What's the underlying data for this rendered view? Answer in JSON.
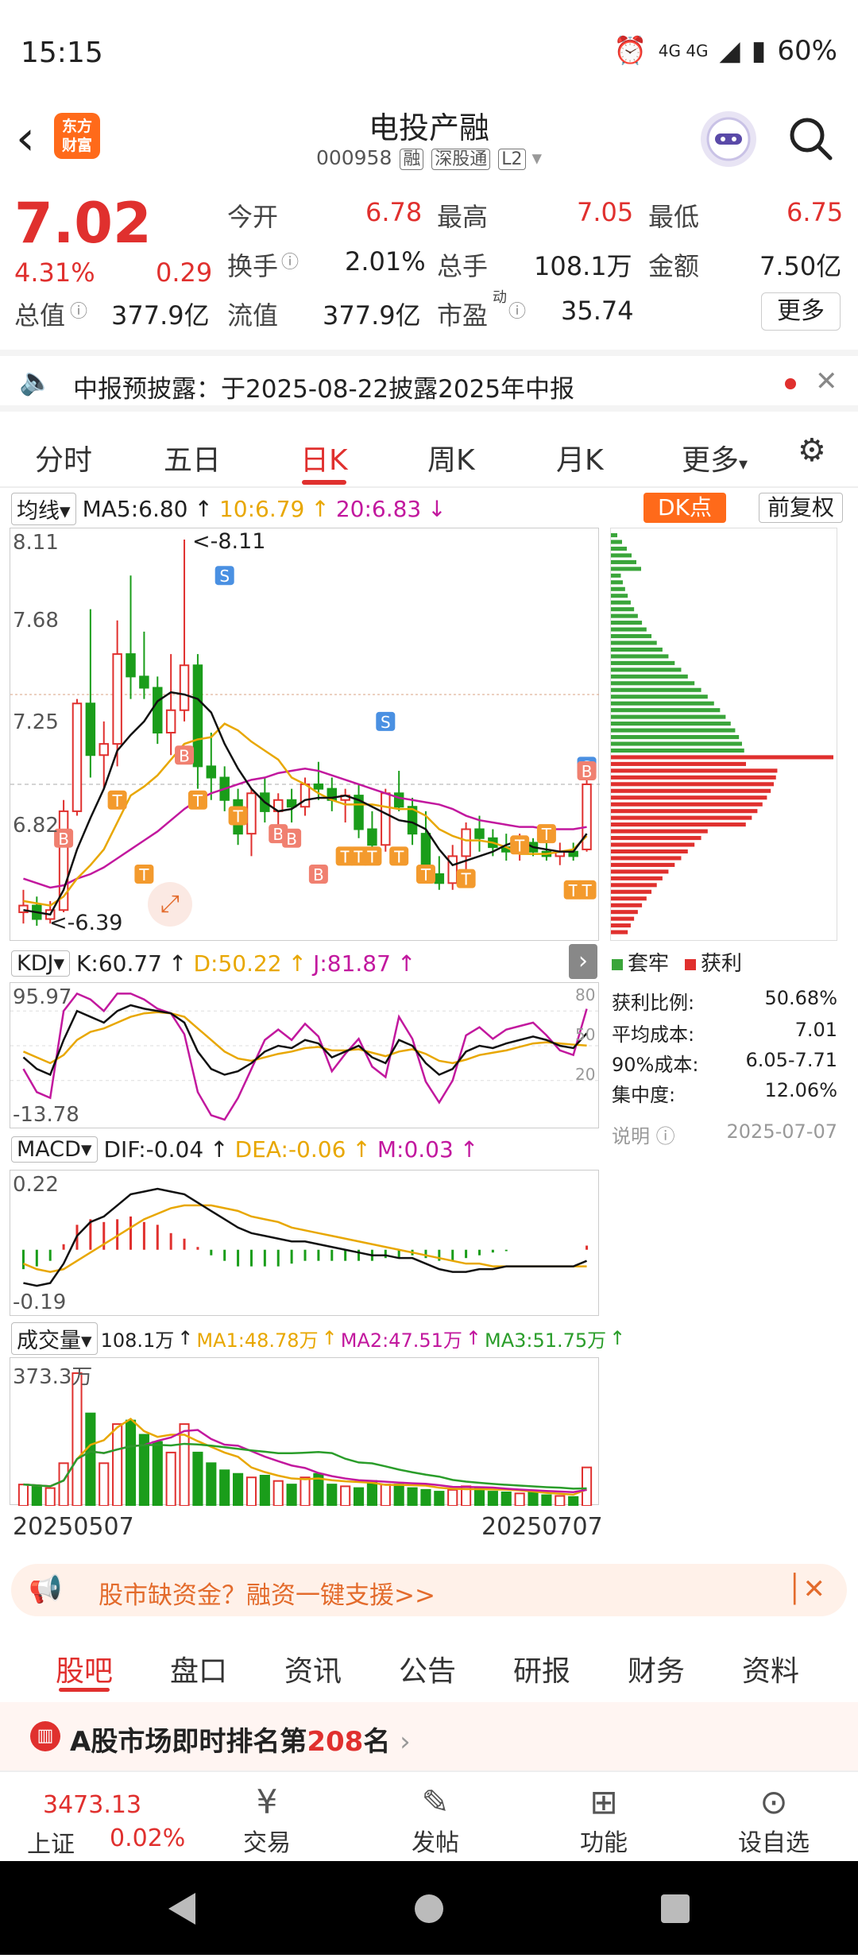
{
  "status_bar": {
    "time": "15:15",
    "network": "4G 4G",
    "battery": "60%"
  },
  "header": {
    "title": "电投产融",
    "code": "000958",
    "tags": [
      "融",
      "深股通",
      "L2"
    ],
    "logo_text": "东方财富"
  },
  "quote": {
    "price": "7.02",
    "change_pct": "4.31%",
    "change": "0.29",
    "open_label": "今开",
    "open": "6.78",
    "high_label": "最高",
    "high": "7.05",
    "low_label": "最低",
    "low": "6.75",
    "turnover_label": "换手",
    "turnover": "2.01%",
    "volume_label": "总手",
    "volume": "108.1万",
    "amount_label": "金额",
    "amount": "7.50亿",
    "total_mv_label": "总值",
    "total_mv": "377.9亿",
    "float_mv_label": "流值",
    "float_mv": "377.9亿",
    "pe_label": "市盈",
    "pe_sup": "动",
    "pe": "35.74",
    "more": "更多"
  },
  "notice": {
    "text": "中报预披露：于2025-08-22披露2025年中报"
  },
  "tabs": [
    "分时",
    "五日",
    "日K",
    "周K",
    "月K",
    "更多"
  ],
  "active_tab": "日K",
  "ma": {
    "selector": "均线",
    "ma5": "MA5:6.80",
    "ma10": "10:6.79",
    "ma20": "20:6.83",
    "dk": "DK点",
    "adjust": "前复权"
  },
  "kline_axis": {
    "y_labels": [
      "8.11",
      "7.68",
      "7.25",
      "6.82",
      "6.39"
    ],
    "high_mark": "<-8.11",
    "low_mark": "<-6.39"
  },
  "kdj": {
    "selector": "KDJ",
    "k": "K:60.77",
    "d": "D:50.22",
    "j": "J:81.87",
    "y_top": "95.97",
    "y_bottom": "-13.78",
    "right_labels": [
      "80",
      "50",
      "20"
    ]
  },
  "macd": {
    "selector": "MACD",
    "dif": "DIF:-0.04",
    "dea": "DEA:-0.06",
    "m": "M:0.03",
    "y_top": "0.22",
    "y_bottom": "-0.19"
  },
  "volume": {
    "selector": "成交量",
    "vol": "108.1万",
    "ma1": "MA1:48.78万",
    "ma2": "MA2:47.51万",
    "ma3": "MA3:51.75万",
    "y_top": "373.3万",
    "date_start": "20250507",
    "date_end": "20250707"
  },
  "chip": {
    "legend_trapped": "套牢",
    "legend_profit": "获利",
    "stats": [
      {
        "label": "获利比例:",
        "value": "50.68%"
      },
      {
        "label": "平均成本:",
        "value": "7.01"
      },
      {
        "label": "90%成本:",
        "value": "6.05-7.71"
      },
      {
        "label": "集中度:",
        "value": "12.06%"
      }
    ],
    "note_label": "说明",
    "date": "2025-07-07"
  },
  "ad": {
    "text": "股市缺资金？融资一键支援>>"
  },
  "bottom_tabs": [
    "股吧",
    "盘口",
    "资讯",
    "公告",
    "研报",
    "财务",
    "资料"
  ],
  "rank": {
    "prefix": "A股市场即时排名第",
    "num": "208",
    "suffix": "名"
  },
  "bottom_bar": {
    "index_value": "3473.13",
    "index_name": "上证",
    "index_change": "0.02%",
    "items": [
      "交易",
      "发帖",
      "功能",
      "设自选"
    ]
  },
  "chart_data": {
    "type": "candlestick",
    "title": "电投产融 日K",
    "x_range": [
      "20250507",
      "20250707"
    ],
    "ylim": [
      6.39,
      8.11
    ],
    "candles": [
      {
        "o": 6.45,
        "h": 6.55,
        "l": 6.4,
        "c": 6.48
      },
      {
        "o": 6.48,
        "h": 6.52,
        "l": 6.39,
        "c": 6.42
      },
      {
        "o": 6.42,
        "h": 6.5,
        "l": 6.4,
        "c": 6.46
      },
      {
        "o": 6.46,
        "h": 6.95,
        "l": 6.45,
        "c": 6.9
      },
      {
        "o": 6.9,
        "h": 7.4,
        "l": 6.88,
        "c": 7.38
      },
      {
        "o": 7.38,
        "h": 7.8,
        "l": 7.05,
        "c": 7.15
      },
      {
        "o": 7.15,
        "h": 7.3,
        "l": 7.0,
        "c": 7.2
      },
      {
        "o": 7.2,
        "h": 7.75,
        "l": 7.1,
        "c": 7.6
      },
      {
        "o": 7.6,
        "h": 7.95,
        "l": 7.4,
        "c": 7.5
      },
      {
        "o": 7.5,
        "h": 7.7,
        "l": 7.4,
        "c": 7.45
      },
      {
        "o": 7.45,
        "h": 7.5,
        "l": 7.2,
        "c": 7.25
      },
      {
        "o": 7.25,
        "h": 7.6,
        "l": 7.15,
        "c": 7.35
      },
      {
        "o": 7.35,
        "h": 8.11,
        "l": 7.3,
        "c": 7.55
      },
      {
        "o": 7.55,
        "h": 7.6,
        "l": 7.0,
        "c": 7.1
      },
      {
        "o": 7.1,
        "h": 7.25,
        "l": 6.95,
        "c": 7.05
      },
      {
        "o": 7.05,
        "h": 7.1,
        "l": 6.9,
        "c": 6.95
      },
      {
        "o": 6.95,
        "h": 7.0,
        "l": 6.75,
        "c": 6.8
      },
      {
        "o": 6.8,
        "h": 7.0,
        "l": 6.7,
        "c": 6.98
      },
      {
        "o": 6.98,
        "h": 7.05,
        "l": 6.85,
        "c": 6.9
      },
      {
        "o": 6.9,
        "h": 6.98,
        "l": 6.82,
        "c": 6.95
      },
      {
        "o": 6.95,
        "h": 7.0,
        "l": 6.85,
        "c": 6.92
      },
      {
        "o": 6.92,
        "h": 7.05,
        "l": 6.88,
        "c": 7.02
      },
      {
        "o": 7.02,
        "h": 7.12,
        "l": 6.95,
        "c": 7.0
      },
      {
        "o": 7.0,
        "h": 7.05,
        "l": 6.9,
        "c": 6.95
      },
      {
        "o": 6.95,
        "h": 7.0,
        "l": 6.85,
        "c": 6.97
      },
      {
        "o": 6.97,
        "h": 7.02,
        "l": 6.78,
        "c": 6.82
      },
      {
        "o": 6.82,
        "h": 6.9,
        "l": 6.7,
        "c": 6.75
      },
      {
        "o": 6.75,
        "h": 7.0,
        "l": 6.72,
        "c": 6.98
      },
      {
        "o": 6.98,
        "h": 7.08,
        "l": 6.9,
        "c": 6.92
      },
      {
        "o": 6.92,
        "h": 6.96,
        "l": 6.75,
        "c": 6.8
      },
      {
        "o": 6.8,
        "h": 6.9,
        "l": 6.58,
        "c": 6.62
      },
      {
        "o": 6.62,
        "h": 6.7,
        "l": 6.55,
        "c": 6.58
      },
      {
        "o": 6.58,
        "h": 6.75,
        "l": 6.55,
        "c": 6.7
      },
      {
        "o": 6.7,
        "h": 6.85,
        "l": 6.62,
        "c": 6.82
      },
      {
        "o": 6.82,
        "h": 6.88,
        "l": 6.72,
        "c": 6.78
      },
      {
        "o": 6.78,
        "h": 6.82,
        "l": 6.7,
        "c": 6.74
      },
      {
        "o": 6.74,
        "h": 6.8,
        "l": 6.68,
        "c": 6.72
      },
      {
        "o": 6.72,
        "h": 6.8,
        "l": 6.68,
        "c": 6.76
      },
      {
        "o": 6.76,
        "h": 6.78,
        "l": 6.7,
        "c": 6.72
      },
      {
        "o": 6.72,
        "h": 6.76,
        "l": 6.68,
        "c": 6.7
      },
      {
        "o": 6.7,
        "h": 6.76,
        "l": 6.66,
        "c": 6.72
      },
      {
        "o": 6.72,
        "h": 6.76,
        "l": 6.68,
        "c": 6.7
      },
      {
        "o": 6.73,
        "h": 7.05,
        "l": 6.72,
        "c": 7.02
      }
    ],
    "ma5": [
      6.46,
      6.45,
      6.44,
      6.55,
      6.73,
      6.87,
      7.0,
      7.17,
      7.24,
      7.3,
      7.39,
      7.43,
      7.42,
      7.4,
      7.34,
      7.2,
      7.09,
      7.0,
      6.94,
      6.9,
      6.91,
      6.95,
      6.96,
      6.96,
      6.97,
      6.95,
      6.92,
      6.89,
      6.86,
      6.85,
      6.82,
      6.73,
      6.66,
      6.68,
      6.7,
      6.72,
      6.75,
      6.77,
      6.74,
      6.73,
      6.72,
      6.72,
      6.8
    ],
    "ma10": [
      6.5,
      6.49,
      6.48,
      6.52,
      6.6,
      6.66,
      6.73,
      6.85,
      6.97,
      7.01,
      7.06,
      7.13,
      7.2,
      7.22,
      7.23,
      7.29,
      7.26,
      7.21,
      7.17,
      7.13,
      7.05,
      7.02,
      6.98,
      6.95,
      6.93,
      6.93,
      6.93,
      6.92,
      6.91,
      6.91,
      6.88,
      6.82,
      6.79,
      6.77,
      6.77,
      6.76,
      6.74,
      6.71,
      6.71,
      6.71,
      6.72,
      6.73,
      6.79
    ],
    "ma20": [
      6.6,
      6.58,
      6.56,
      6.57,
      6.6,
      6.62,
      6.65,
      6.69,
      6.73,
      6.77,
      6.81,
      6.86,
      6.91,
      6.95,
      6.98,
      7.0,
      7.02,
      7.04,
      7.05,
      7.07,
      7.08,
      7.09,
      7.08,
      7.06,
      7.04,
      7.02,
      7.0,
      6.98,
      6.96,
      6.95,
      6.94,
      6.93,
      6.91,
      6.88,
      6.86,
      6.85,
      6.84,
      6.83,
      6.83,
      6.82,
      6.82,
      6.82,
      6.83
    ],
    "kdj": {
      "k": [
        40,
        30,
        25,
        55,
        80,
        75,
        70,
        80,
        85,
        82,
        80,
        78,
        70,
        45,
        30,
        25,
        28,
        35,
        45,
        50,
        48,
        55,
        52,
        40,
        45,
        50,
        40,
        35,
        55,
        50,
        35,
        25,
        30,
        45,
        50,
        48,
        52,
        55,
        58,
        55,
        50,
        48,
        60.77
      ],
      "d": [
        45,
        40,
        35,
        42,
        55,
        62,
        65,
        70,
        75,
        78,
        79,
        78,
        75,
        65,
        55,
        45,
        39,
        37,
        40,
        43,
        45,
        48,
        49,
        46,
        46,
        47,
        44,
        41,
        45,
        47,
        43,
        37,
        35,
        38,
        42,
        44,
        46,
        49,
        52,
        53,
        52,
        51,
        50.22
      ],
      "j": [
        30,
        10,
        5,
        80,
        95,
        90,
        80,
        95,
        95,
        90,
        82,
        78,
        60,
        10,
        -10,
        -13.78,
        5,
        30,
        55,
        64,
        55,
        69,
        58,
        28,
        43,
        56,
        32,
        23,
        75,
        56,
        19,
        1,
        20,
        59,
        66,
        56,
        64,
        67,
        70,
        59,
        46,
        42,
        81.87
      ]
    },
    "macd": {
      "dif": [
        -0.12,
        -0.13,
        -0.12,
        -0.05,
        0.05,
        0.1,
        0.12,
        0.16,
        0.2,
        0.21,
        0.22,
        0.21,
        0.2,
        0.17,
        0.14,
        0.11,
        0.08,
        0.06,
        0.05,
        0.04,
        0.03,
        0.03,
        0.02,
        0.01,
        0.0,
        -0.01,
        -0.02,
        -0.02,
        -0.03,
        -0.03,
        -0.05,
        -0.07,
        -0.08,
        -0.08,
        -0.07,
        -0.07,
        -0.06,
        -0.06,
        -0.06,
        -0.06,
        -0.06,
        -0.06,
        -0.04
      ],
      "dea": [
        -0.05,
        -0.07,
        -0.08,
        -0.07,
        -0.04,
        -0.01,
        0.02,
        0.05,
        0.08,
        0.11,
        0.13,
        0.15,
        0.16,
        0.16,
        0.16,
        0.15,
        0.14,
        0.12,
        0.11,
        0.1,
        0.08,
        0.07,
        0.06,
        0.05,
        0.04,
        0.03,
        0.02,
        0.01,
        0.0,
        -0.01,
        -0.02,
        -0.03,
        -0.04,
        -0.05,
        -0.05,
        -0.06,
        -0.06,
        -0.06,
        -0.06,
        -0.06,
        -0.06,
        -0.06,
        -0.06
      ],
      "m": [
        -0.14,
        -0.12,
        -0.08,
        0.04,
        0.18,
        0.22,
        0.2,
        0.22,
        0.24,
        0.2,
        0.18,
        0.12,
        0.08,
        0.02,
        -0.04,
        -0.08,
        -0.12,
        -0.12,
        -0.12,
        -0.12,
        -0.1,
        -0.08,
        -0.08,
        -0.08,
        -0.08,
        -0.08,
        -0.08,
        -0.06,
        -0.06,
        -0.04,
        -0.06,
        -0.08,
        -0.08,
        -0.06,
        -0.04,
        -0.02,
        -0.01,
        0.0,
        0.0,
        0.0,
        0.0,
        0.0,
        0.03
      ]
    },
    "volume": [
      60,
      55,
      50,
      120,
      373.3,
      260,
      120,
      230,
      240,
      200,
      180,
      150,
      230,
      150,
      120,
      100,
      90,
      80,
      85,
      70,
      60,
      80,
      90,
      60,
      55,
      50,
      70,
      60,
      60,
      50,
      45,
      40,
      45,
      55,
      50,
      40,
      38,
      35,
      40,
      30,
      28,
      25,
      108.1
    ],
    "chip_profit_ratio": "50.68%"
  }
}
